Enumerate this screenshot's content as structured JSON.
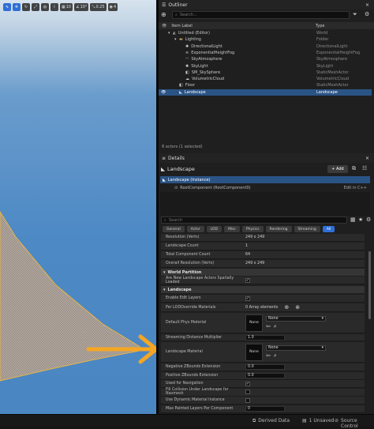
{
  "viewport": {
    "toolbar": [
      {
        "icon": "select-icon",
        "label": "",
        "selected": true
      },
      {
        "icon": "move-icon",
        "label": "",
        "selected": true
      },
      {
        "icon": "rotate-icon",
        "label": ""
      },
      {
        "icon": "scale-icon",
        "label": ""
      },
      {
        "icon": "world-icon",
        "label": ""
      },
      {
        "icon": "surface-snap-icon",
        "label": ""
      },
      {
        "icon": "grid-snap-icon",
        "label": "10"
      },
      {
        "icon": "rotation-snap-icon",
        "label": "10°"
      },
      {
        "icon": "scale-snap-icon",
        "label": "0.25"
      },
      {
        "icon": "camera-speed-icon",
        "label": "4"
      }
    ]
  },
  "outliner": {
    "tab_title": "Outliner",
    "search_placeholder": "Search...",
    "col_label": "Item Label",
    "col_type": "Type",
    "items": [
      {
        "label": "Untitled (Editor)",
        "type": "World",
        "indent": 0,
        "icon": "world-icon"
      },
      {
        "label": "Lighting",
        "type": "Folder",
        "indent": 1,
        "icon": "folder-icon"
      },
      {
        "label": "DirectionalLight",
        "type": "DirectionalLight",
        "indent": 2,
        "icon": "light-icon"
      },
      {
        "label": "ExponentialHeightFog",
        "type": "ExponentialHeightFog",
        "indent": 2,
        "icon": "fog-icon"
      },
      {
        "label": "SkyAtmosphere",
        "type": "SkyAtmosphere",
        "indent": 2,
        "icon": "sky-icon"
      },
      {
        "label": "SkyLight",
        "type": "SkyLight",
        "indent": 2,
        "icon": "light-icon"
      },
      {
        "label": "SM_SkySphere",
        "type": "StaticMeshActor",
        "indent": 2,
        "icon": "mesh-icon"
      },
      {
        "label": "VolumetricCloud",
        "type": "VolumetricCloud",
        "indent": 2,
        "icon": "cloud-icon"
      },
      {
        "label": "Floor",
        "type": "StaticMeshActor",
        "indent": 1,
        "icon": "mesh-icon"
      },
      {
        "label": "Landscape",
        "type": "Landscape",
        "indent": 1,
        "icon": "landscape-icon",
        "selected": true
      }
    ],
    "status": "8 actors (1 selected)"
  },
  "details": {
    "tab_title": "Details",
    "actor_name": "Landscape",
    "add_label": "+ Add",
    "instance_label": "Landscape (Instance)",
    "root_component": "RootComponent (RootComponent0)",
    "edit_cpp": "Edit in C++",
    "search_placeholder": "Search",
    "filter_tabs": [
      "General",
      "Actor",
      "LOD",
      "Misc",
      "Physics",
      "Rendering",
      "Streaming",
      "All"
    ],
    "rows_top": [
      {
        "label": "Resolution (Verts)",
        "value": "249 x 249"
      },
      {
        "label": "Landscape Count",
        "value": "1"
      },
      {
        "label": "Total Component Count",
        "value": "64"
      },
      {
        "label": "Overall Resolution (Verts)",
        "value": "249 x 249"
      }
    ],
    "section_world": "World Partition",
    "row_spatial": "Are New Landscape Actors Spatially Loaded",
    "section_landscape": "Landscape",
    "row_edit_layers": "Enable Edit Layers",
    "row_lod_override": "Per LODOverride Materials",
    "lod_override_value": "0 Array elements",
    "row_phys_mat": "Default Phys Material",
    "thumb_none": "None",
    "dd_none": "None",
    "row_streaming": "Streaming Distance Multiplier",
    "streaming_value": "1.0",
    "row_landscape_mat": "Landscape Material",
    "rows_bottom": [
      {
        "label": "Negative ZBounds Extension",
        "value": "0.0",
        "kind": "num"
      },
      {
        "label": "Positive ZBounds Extension",
        "value": "0.0",
        "kind": "num"
      },
      {
        "label": "Used for Navigation",
        "value": "",
        "kind": "check-on"
      },
      {
        "label": "Fill Collision Under Landscape for Navmesh",
        "value": "",
        "kind": "check-off"
      },
      {
        "label": "Use Dynamic Material Instance",
        "value": "",
        "kind": "check-off"
      },
      {
        "label": "Max Painted Layers Per Component",
        "value": "0",
        "kind": "num"
      }
    ]
  },
  "statusbar": {
    "derived_data": "Derived Data",
    "unsaved": "1 Unsaved",
    "source_control": "Source Control"
  },
  "colors": {
    "accent": "#2f6fd8",
    "arrow": "#f5a623",
    "selection": "#2b5486"
  }
}
